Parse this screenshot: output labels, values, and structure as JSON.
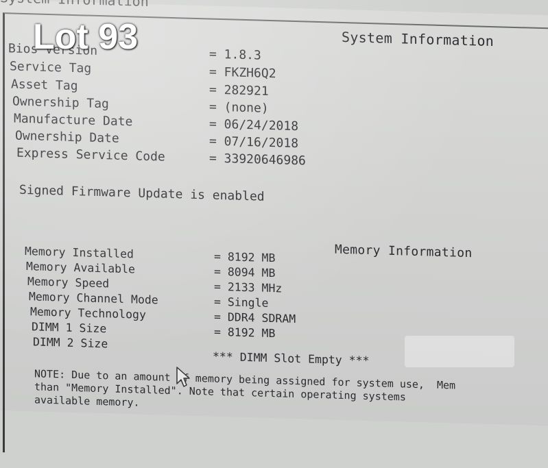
{
  "window": {
    "title": "System Information"
  },
  "overlay": {
    "lot_label": "Lot 93"
  },
  "system_info": {
    "title": "System Information",
    "rows": [
      {
        "label": "Bios Version",
        "value": "= 1.8.3"
      },
      {
        "label": "Service Tag",
        "value": "= FKZH6Q2"
      },
      {
        "label": "Asset Tag",
        "value": "= 282921"
      },
      {
        "label": "Ownership Tag",
        "value": "= (none)"
      },
      {
        "label": "Manufacture Date",
        "value": "= 06/24/2018"
      },
      {
        "label": "Ownership Date",
        "value": "= 07/16/2018"
      },
      {
        "label": "Express Service Code",
        "value": "= 33920646986"
      }
    ],
    "firmware_note": "Signed Firmware Update is enabled"
  },
  "memory_info": {
    "title": "Memory Information",
    "rows": [
      {
        "label": "Memory Installed",
        "value": "= 8192 MB"
      },
      {
        "label": "Memory Available",
        "value": "= 8094 MB"
      },
      {
        "label": "Memory Speed",
        "value": "= 2133 MHz"
      },
      {
        "label": "Memory Channel Mode",
        "value": "= Single"
      },
      {
        "label": "Memory Technology",
        "value": "= DDR4 SDRAM"
      },
      {
        "label": "DIMM 1 Size",
        "value": "= 8192 MB"
      },
      {
        "label": "DIMM 2 Size",
        "value": "*** DIMM Slot Empty ***"
      }
    ],
    "note_lines": [
      "NOTE: Due to an amount of memory being assigned for system use,  Mem",
      "than \"Memory Installed\". Note that certain operating systems",
      "available memory."
    ]
  }
}
